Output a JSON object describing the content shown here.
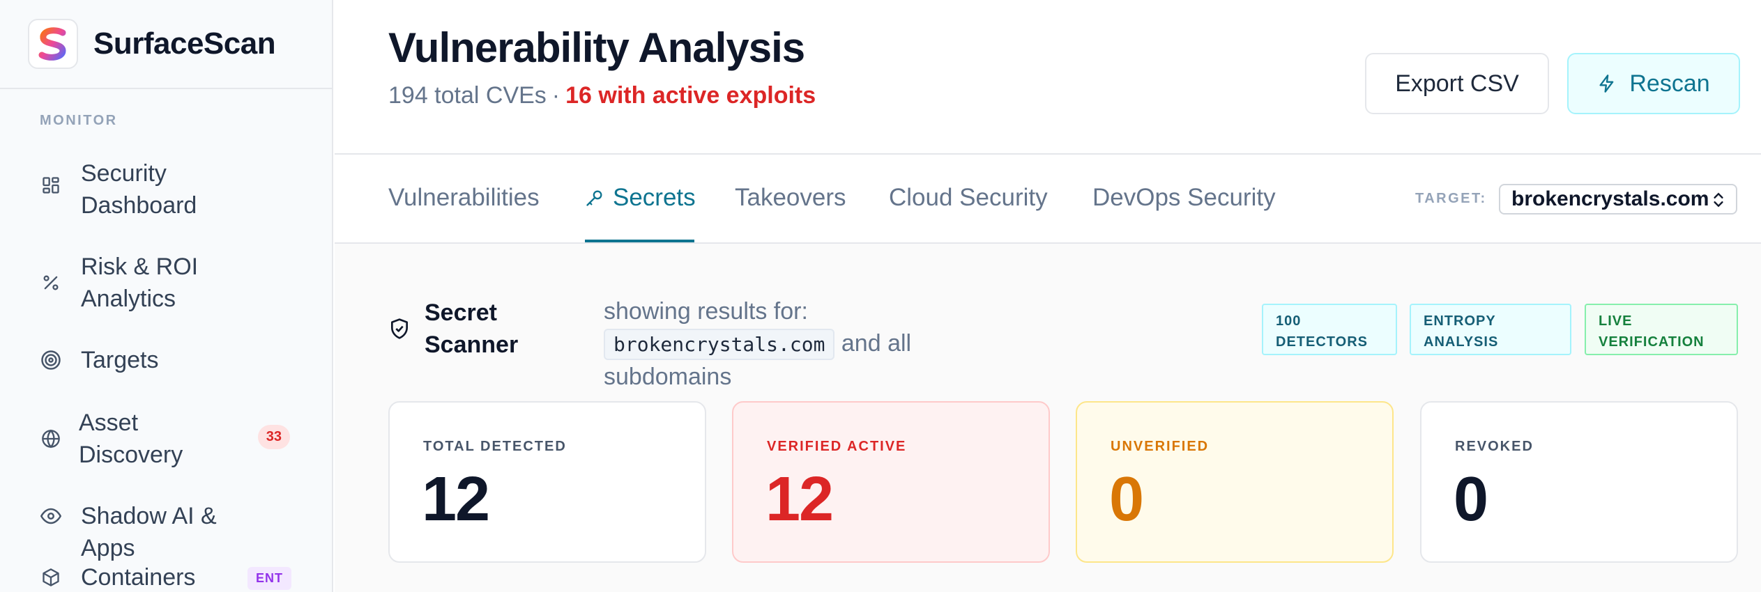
{
  "app": {
    "name": "SurfaceScan"
  },
  "sidebar": {
    "section": "MONITOR",
    "items": [
      {
        "label": "Security Dashboard",
        "icon": "dashboard-grid-icon"
      },
      {
        "label": "Risk & ROI Analytics",
        "icon": "percent-icon"
      },
      {
        "label": "Targets",
        "icon": "target-icon"
      },
      {
        "label": "Asset Discovery",
        "icon": "globe-icon",
        "badge": "33"
      },
      {
        "label": "Shadow AI & Apps",
        "icon": "eye-icon"
      },
      {
        "label": "Containers",
        "icon": "cube-icon",
        "badge": "ENT"
      }
    ]
  },
  "header": {
    "title": "Vulnerability Analysis",
    "cve_total": "194 total CVEs",
    "separator": "·",
    "active_exploits": "16 with active exploits",
    "export_label": "Export CSV",
    "rescan_label": "Rescan"
  },
  "tabs": {
    "items": [
      "Vulnerabilities",
      "Secrets",
      "Takeovers",
      "Cloud Security",
      "DevOps Security"
    ],
    "active": "Secrets",
    "target_label": "TARGET:",
    "target_value": "brokencrystals.com"
  },
  "scanner": {
    "title": "Secret Scanner",
    "desc_prefix": "showing results for:",
    "domain": "brokencrystals.com",
    "desc_suffix": "and all subdomains",
    "chips": [
      "100 DETECTORS",
      "ENTROPY ANALYSIS",
      "LIVE VERIFICATION"
    ]
  },
  "stats": [
    {
      "label": "TOTAL DETECTED",
      "value": "12"
    },
    {
      "label": "VERIFIED ACTIVE",
      "value": "12"
    },
    {
      "label": "UNVERIFIED",
      "value": "0"
    },
    {
      "label": "REVOKED",
      "value": "0"
    }
  ],
  "colors": {
    "accent": "#0e7490",
    "danger": "#dc2626",
    "warning": "#d97706"
  }
}
